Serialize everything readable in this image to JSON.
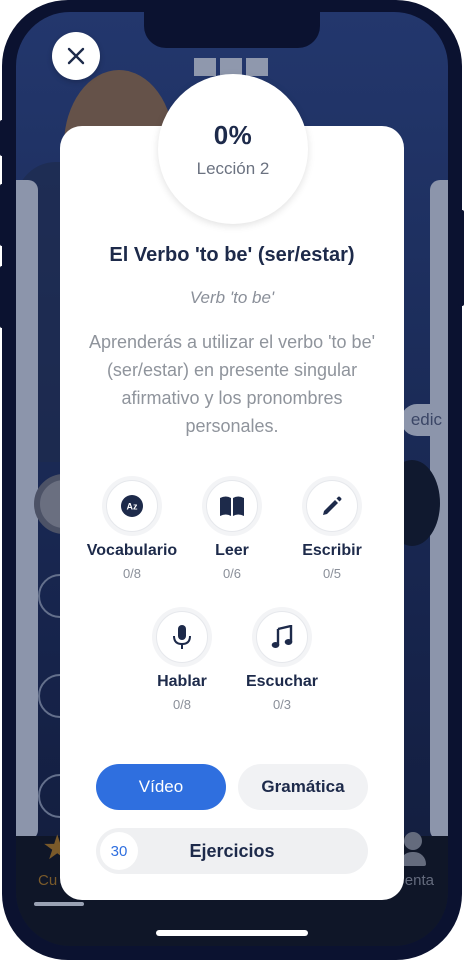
{
  "background": {
    "peek_label": "edic",
    "tab_left_label": "Cu",
    "tab_right_label": "enta"
  },
  "close_icon": "close-icon",
  "progress": {
    "percent_label": "0%",
    "lesson_label": "Lección 2"
  },
  "lesson": {
    "title": "El Verbo 'to be' (ser/estar)",
    "subtitle": "Verb 'to be'",
    "description": "Aprenderás a utilizar el verbo 'to be' (ser/estar) en presente singular afirmativo y los pronombres personales."
  },
  "skills": [
    {
      "label": "Vocabulario",
      "count": "0/8",
      "icon": "az-icon"
    },
    {
      "label": "Leer",
      "count": "0/6",
      "icon": "book-icon"
    },
    {
      "label": "Escribir",
      "count": "0/5",
      "icon": "pencil-icon"
    },
    {
      "label": "Hablar",
      "count": "0/8",
      "icon": "microphone-icon"
    },
    {
      "label": "Escuchar",
      "count": "0/3",
      "icon": "music-note-icon"
    }
  ],
  "tabs": {
    "video_label": "Vídeo",
    "grammar_label": "Gramática"
  },
  "exercises": {
    "count": "30",
    "label": "Ejercicios"
  },
  "colors": {
    "accent": "#2f6fdf",
    "dark_text": "#1d2a4a",
    "frame": "#0b1230"
  }
}
